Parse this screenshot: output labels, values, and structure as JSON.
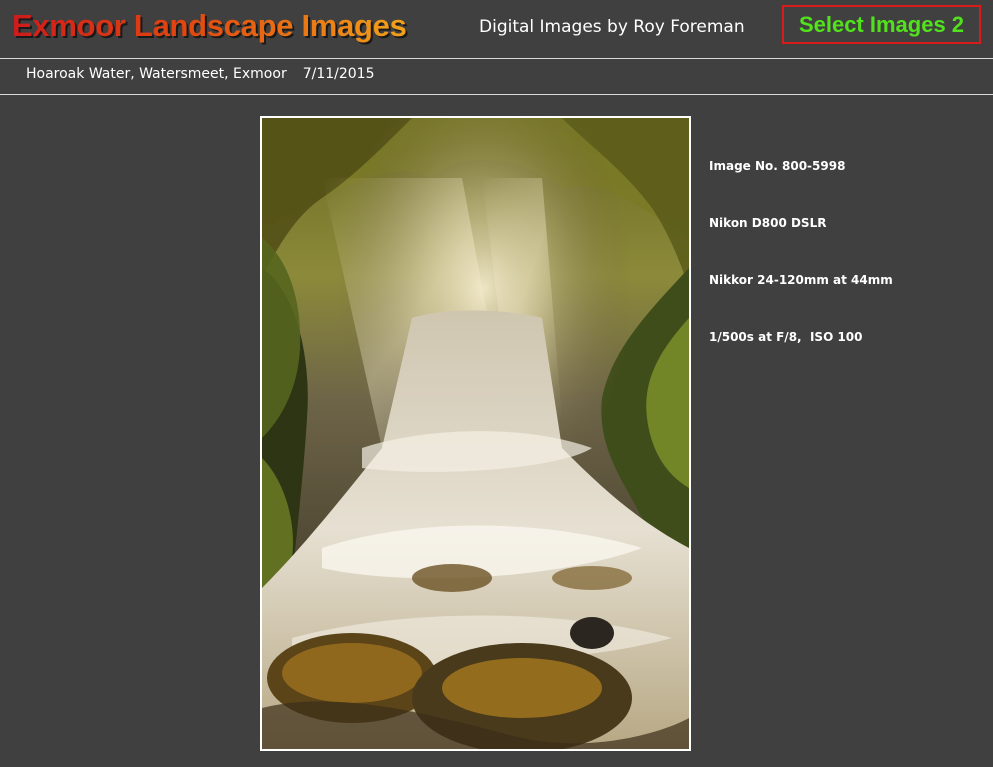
{
  "header": {
    "site_title": "Exmoor Landscape Images",
    "subtitle": "Digital Images by Roy Foreman",
    "select_button": "Select Images 2"
  },
  "caption": {
    "location": "Hoaroak Water, Watersmeet, Exmoor",
    "date": "7/11/2015"
  },
  "photo": {
    "alt": "Hoaroak Water, Watersmeet, Exmoor"
  },
  "info": {
    "image_no": "Image No. 800-5998",
    "camera": "Nikon D800 DSLR",
    "lens": "Nikkor 24-120mm at 44mm",
    "exposure": "1/500s at F/8,  ISO 100"
  },
  "colors": {
    "background": "#404040",
    "title_gradient_start": "#d01b1b",
    "title_gradient_end": "#f2a21a",
    "button_text": "#52e21c",
    "button_border": "#d81b1b"
  }
}
